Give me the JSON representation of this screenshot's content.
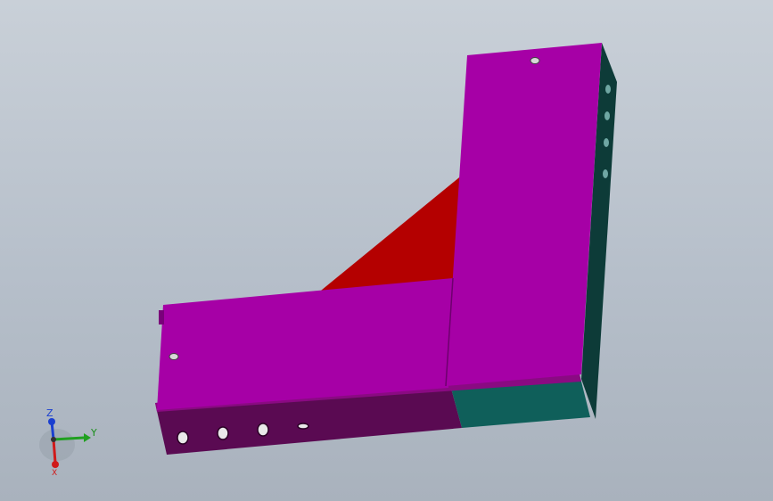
{
  "colors": {
    "background_top": "#c9d0d8",
    "background_bottom": "#a9b2bd",
    "cover_face": "#a600a6",
    "cover_edge": "#7a007a",
    "trough_side": "#5a0a52",
    "gusset": "#b40000",
    "teal_section": "#0f5f5a",
    "side_dark": "#0d3b38",
    "hole": "#d8d8d8"
  },
  "triad": {
    "z_label": "Z",
    "y_label": "Y",
    "x_label": "X"
  }
}
